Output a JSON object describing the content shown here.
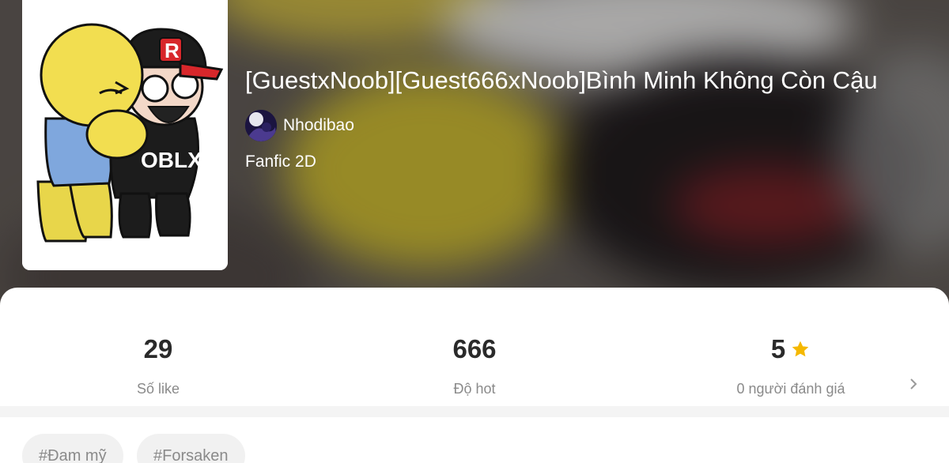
{
  "story": {
    "title": "[GuestxNoob][Guest666xNoob]Bình Minh Không Còn Cậu",
    "author": "Nhodibao",
    "category": "Fanfic 2D"
  },
  "stats": {
    "likes": {
      "value": "29",
      "label": "Số like"
    },
    "hot": {
      "value": "666",
      "label": "Độ hot"
    },
    "rating": {
      "value": "5",
      "label": "0 người đánh giá",
      "icon": "star-icon"
    }
  },
  "tags": [
    "#Đam mỹ",
    "#Forsaken"
  ],
  "cover_text": {
    "hat_letter": "R",
    "shirt_text": "OBLX"
  },
  "colors": {
    "accent_star": "#f5b800",
    "text_dark": "#2a2a2a",
    "text_muted": "#8a8a8a"
  }
}
